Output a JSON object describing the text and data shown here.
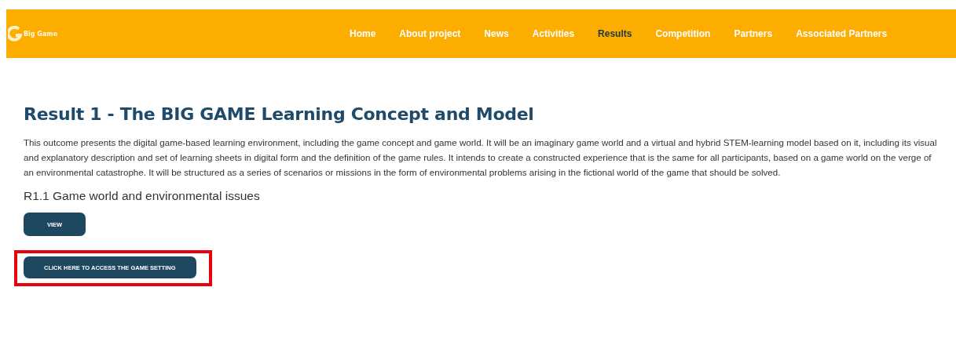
{
  "header": {
    "logo_text": "Big Game",
    "nav": [
      {
        "label": "Home",
        "selected": false
      },
      {
        "label": "About project",
        "selected": false
      },
      {
        "label": "News",
        "selected": false
      },
      {
        "label": "Activities",
        "selected": false
      },
      {
        "label": "Results",
        "selected": true
      },
      {
        "label": "Competition",
        "selected": false
      },
      {
        "label": "Partners",
        "selected": false
      },
      {
        "label": "Associated Partners",
        "selected": false
      }
    ]
  },
  "content": {
    "title": "Result 1 - The BIG GAME Learning Concept and Model",
    "description": "This outcome presents the digital game-based learning environment, including the game concept and game world. It will be an imaginary game world and a virtual and hybrid STEM-learning model based on it, including its visual and explanatory description and set of learning sheets in digital form and the definition of the game rules. It intends to create a constructed experience that is the same for all participants, based on a game world on the verge of an environmental catastrophe. It will be structured as a series of scenarios or missions in the form of environmental problems arising in the fictional world of the game that should be solved.",
    "subtitle": "R1.1 Game world and environmental issues",
    "buttons": [
      {
        "label": "VIEW",
        "highlighted": false
      },
      {
        "label": "CLICK HERE TO ACCESS THE GAME SETTING",
        "highlighted": true
      }
    ]
  }
}
